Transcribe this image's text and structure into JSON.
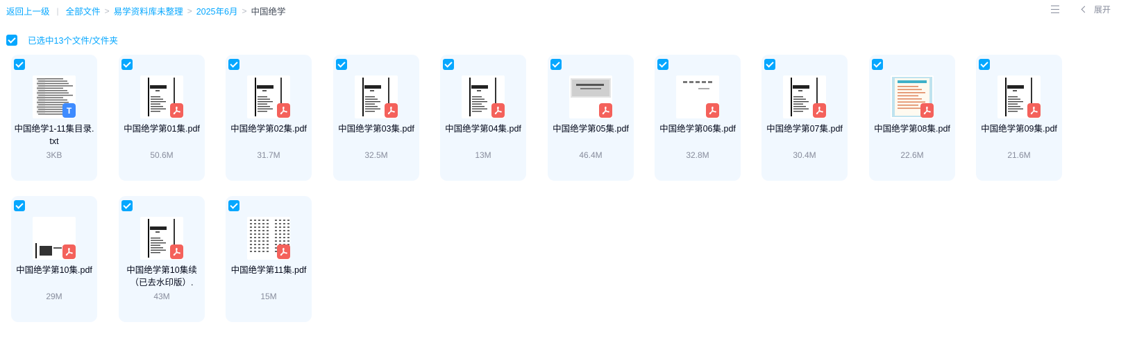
{
  "breadcrumb": {
    "back": "返回上一级",
    "items": [
      "全部文件",
      "易学资料库未整理",
      "2025年6月"
    ],
    "current": "中国绝学"
  },
  "toolbar": {
    "list_icon": "list-view-icon",
    "collapse_icon": "chevron-left-icon",
    "expand_label": "展开"
  },
  "selection": {
    "label": "已选中13个文件/文件夹"
  },
  "colors": {
    "accent": "#06a7ff",
    "card_bg": "#f1f8ff",
    "pdf_badge": "#f4615b",
    "txt_badge": "#3e8bff"
  },
  "files": [
    {
      "name": "中国绝学1-11集目录.txt",
      "size": "3KB",
      "type": "txt",
      "thumb": "list",
      "badge_label": "T"
    },
    {
      "name": "中国绝学第01集.pdf",
      "size": "50.6M",
      "type": "pdf",
      "thumb": "cover"
    },
    {
      "name": "中国绝学第02集.pdf",
      "size": "31.7M",
      "type": "pdf",
      "thumb": "cover"
    },
    {
      "name": "中国绝学第03集.pdf",
      "size": "32.5M",
      "type": "pdf",
      "thumb": "cover"
    },
    {
      "name": "中国绝学第04集.pdf",
      "size": "13M",
      "type": "pdf",
      "thumb": "cover"
    },
    {
      "name": "中国绝学第05集.pdf",
      "size": "46.4M",
      "type": "pdf",
      "thumb": "scan"
    },
    {
      "name": "中国绝学第06集.pdf",
      "size": "32.8M",
      "type": "pdf",
      "thumb": "light"
    },
    {
      "name": "中国绝学第07集.pdf",
      "size": "30.4M",
      "type": "pdf",
      "thumb": "cover"
    },
    {
      "name": "中国绝学第08集.pdf",
      "size": "22.6M",
      "type": "pdf",
      "thumb": "color"
    },
    {
      "name": "中国绝学第09集.pdf",
      "size": "21.6M",
      "type": "pdf",
      "thumb": "cover"
    },
    {
      "name": "中国绝学第10集.pdf",
      "size": "29M",
      "type": "pdf",
      "thumb": "bottom"
    },
    {
      "name": "中国绝学第10集续（已去水印版）.",
      "size": "43M",
      "type": "pdf",
      "thumb": "cover"
    },
    {
      "name": "中国绝学第11集.pdf",
      "size": "15M",
      "type": "pdf",
      "thumb": "columns"
    }
  ]
}
